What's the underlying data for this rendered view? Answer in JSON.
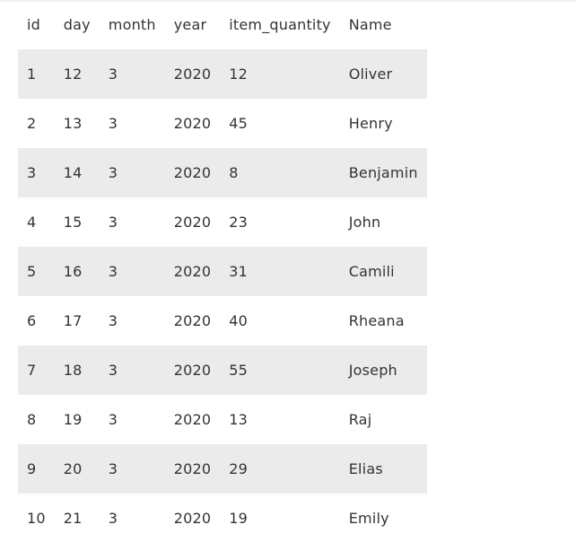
{
  "table": {
    "columns": [
      "id",
      "day",
      "month",
      "year",
      "item_quantity",
      "Name"
    ],
    "rows": [
      [
        "1",
        "12",
        "3",
        "2020",
        "12",
        "Oliver"
      ],
      [
        "2",
        "13",
        "3",
        "2020",
        "45",
        "Henry"
      ],
      [
        "3",
        "14",
        "3",
        "2020",
        "8",
        "Benjamin"
      ],
      [
        "4",
        "15",
        "3",
        "2020",
        "23",
        "John"
      ],
      [
        "5",
        "16",
        "3",
        "2020",
        "31",
        "Camili"
      ],
      [
        "6",
        "17",
        "3",
        "2020",
        "40",
        "Rheana"
      ],
      [
        "7",
        "18",
        "3",
        "2020",
        "55",
        "Joseph"
      ],
      [
        "8",
        "19",
        "3",
        "2020",
        "13",
        "Raj"
      ],
      [
        "9",
        "20",
        "3",
        "2020",
        "29",
        "Elias"
      ],
      [
        "10",
        "21",
        "3",
        "2020",
        "19",
        "Emily"
      ]
    ],
    "colors": {
      "stripe": "#ebebeb",
      "text": "#333333",
      "background": "#ffffff"
    }
  }
}
